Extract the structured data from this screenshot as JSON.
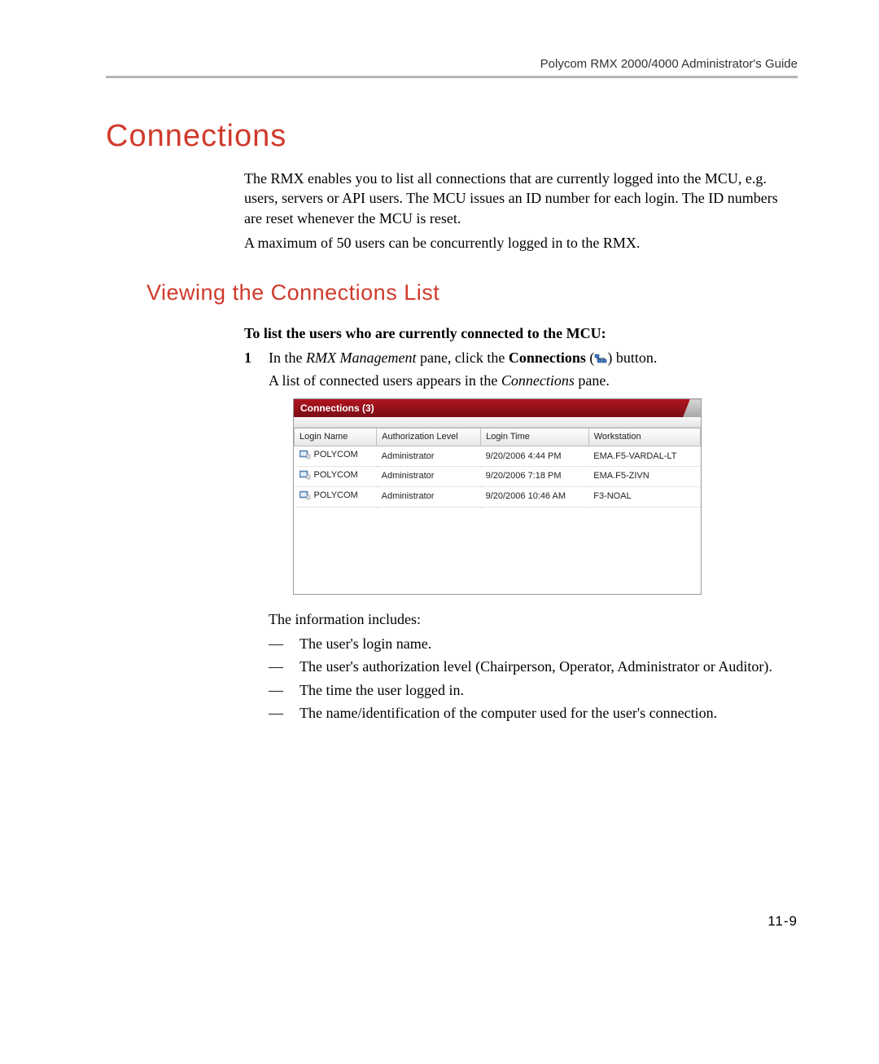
{
  "header": {
    "doc_title": "Polycom RMX 2000/4000 Administrator's Guide"
  },
  "section": {
    "title": "Connections",
    "intro_p1": "The RMX enables you to list all connections that are currently logged into the MCU, e.g. users, servers or API users. The MCU issues an ID number for each login. The ID numbers are reset whenever the MCU is reset.",
    "intro_p2": "A maximum of 50 users can be concurrently logged in to the RMX."
  },
  "subsection": {
    "title": "Viewing the Connections List",
    "lead_bold": "To list the users who are currently connected to the MCU:",
    "step_num": "1",
    "step_a_prefix": "In the ",
    "step_a_italic": "RMX Management",
    "step_a_mid": " pane, click the ",
    "step_a_bold": "Connections",
    "step_a_open": " (",
    "step_a_close": ") button.",
    "step_b_prefix": "A list of connected users appears in the ",
    "step_b_italic": "Connections",
    "step_b_suffix": " pane.",
    "info_lead": "The information includes:",
    "bullets": [
      "The user's login name.",
      "The user's authorization level (Chairperson, Operator, Administrator or Auditor).",
      "The time the user logged in.",
      "The name/identification of the computer used for the user's connection."
    ]
  },
  "panel": {
    "title": "Connections (3)",
    "columns": [
      "Login Name",
      "Authorization Level",
      "Login Time",
      "Workstation"
    ],
    "rows": [
      {
        "login": "POLYCOM",
        "auth": "Administrator",
        "time": "9/20/2006 4:44 PM",
        "ws": "EMA.F5-VARDAL-LT"
      },
      {
        "login": "POLYCOM",
        "auth": "Administrator",
        "time": "9/20/2006 7:18 PM",
        "ws": "EMA.F5-ZIVN"
      },
      {
        "login": "POLYCOM",
        "auth": "Administrator",
        "time": "9/20/2006 10:46 AM",
        "ws": "F3-NOAL"
      }
    ]
  },
  "footer": {
    "page_number": "11-9"
  }
}
